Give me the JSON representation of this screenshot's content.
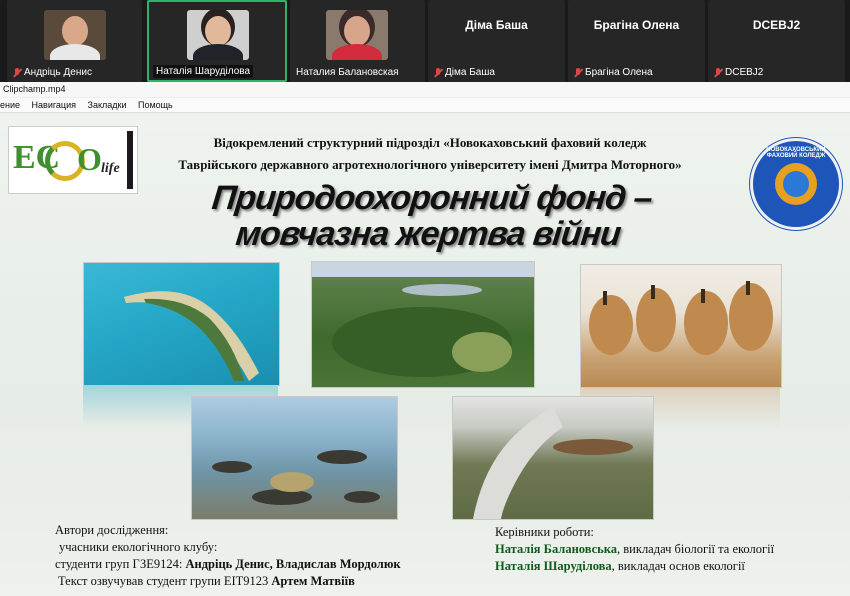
{
  "participants": [
    {
      "label": "Андріць Денис",
      "type": "video",
      "muted": true
    },
    {
      "label": "Наталія Шаруділова",
      "type": "video",
      "muted": false,
      "active": true
    },
    {
      "label": "Наталия Балановская",
      "type": "video",
      "muted": false
    },
    {
      "name": "Діма Баша",
      "label": "Діма Баша",
      "type": "name",
      "muted": true
    },
    {
      "name": "Брагіна Олена",
      "label": "Брагіна Олена",
      "type": "name",
      "muted": true
    },
    {
      "name": "DCEBJ2",
      "label": "DCEBJ2",
      "type": "name",
      "muted": true
    }
  ],
  "player": {
    "title": "Clipchamp.mp4",
    "menu": [
      "ение",
      "Навигация",
      "Закладки",
      "Помощь"
    ]
  },
  "slide": {
    "logo": {
      "left": "EC",
      "right": "O",
      "sub": "life"
    },
    "institution_line1": "Відокремлений структурний підрозділ «Новокаховський фаховий коледж",
    "institution_line2": "Таврійського державного агротехнологічного університету імені Дмитра Моторного»",
    "emblem_text": "НОВОКАХОВСЬКИЙ ФАХОВИЙ КОЛЕДЖ",
    "title_line1": "Природоохоронний фонд –",
    "title_line2": "мовчазна жертва війни",
    "authors_heading": "Автори дослідження:",
    "authors_line1": "учасники екологічного клубу:",
    "authors_line2_prefix": "студенти груп ГЗЕ9124:",
    "authors_line2_names": "Андріць Денис, Владислав Мордолюк",
    "authors_line3_prefix": "Текст озвучував студент групи ЕІТ9123",
    "authors_line3_name": "Артем Матвіїв",
    "supervisors_heading": "Керівники роботи:",
    "supervisor1_name": "Наталія Балановська",
    "supervisor1_role": ", викладач біології та екології",
    "supervisor2_name": "Наталія Шаруділова",
    "supervisor2_role": ", викладач основ екології"
  },
  "colors": {
    "active_border": "#2fb36a",
    "muted_icon": "#e04646",
    "emblem": "#1d55b8",
    "supervisor_name": "#0f5a1f"
  },
  "icons": [
    "microphone-muted-icon"
  ]
}
